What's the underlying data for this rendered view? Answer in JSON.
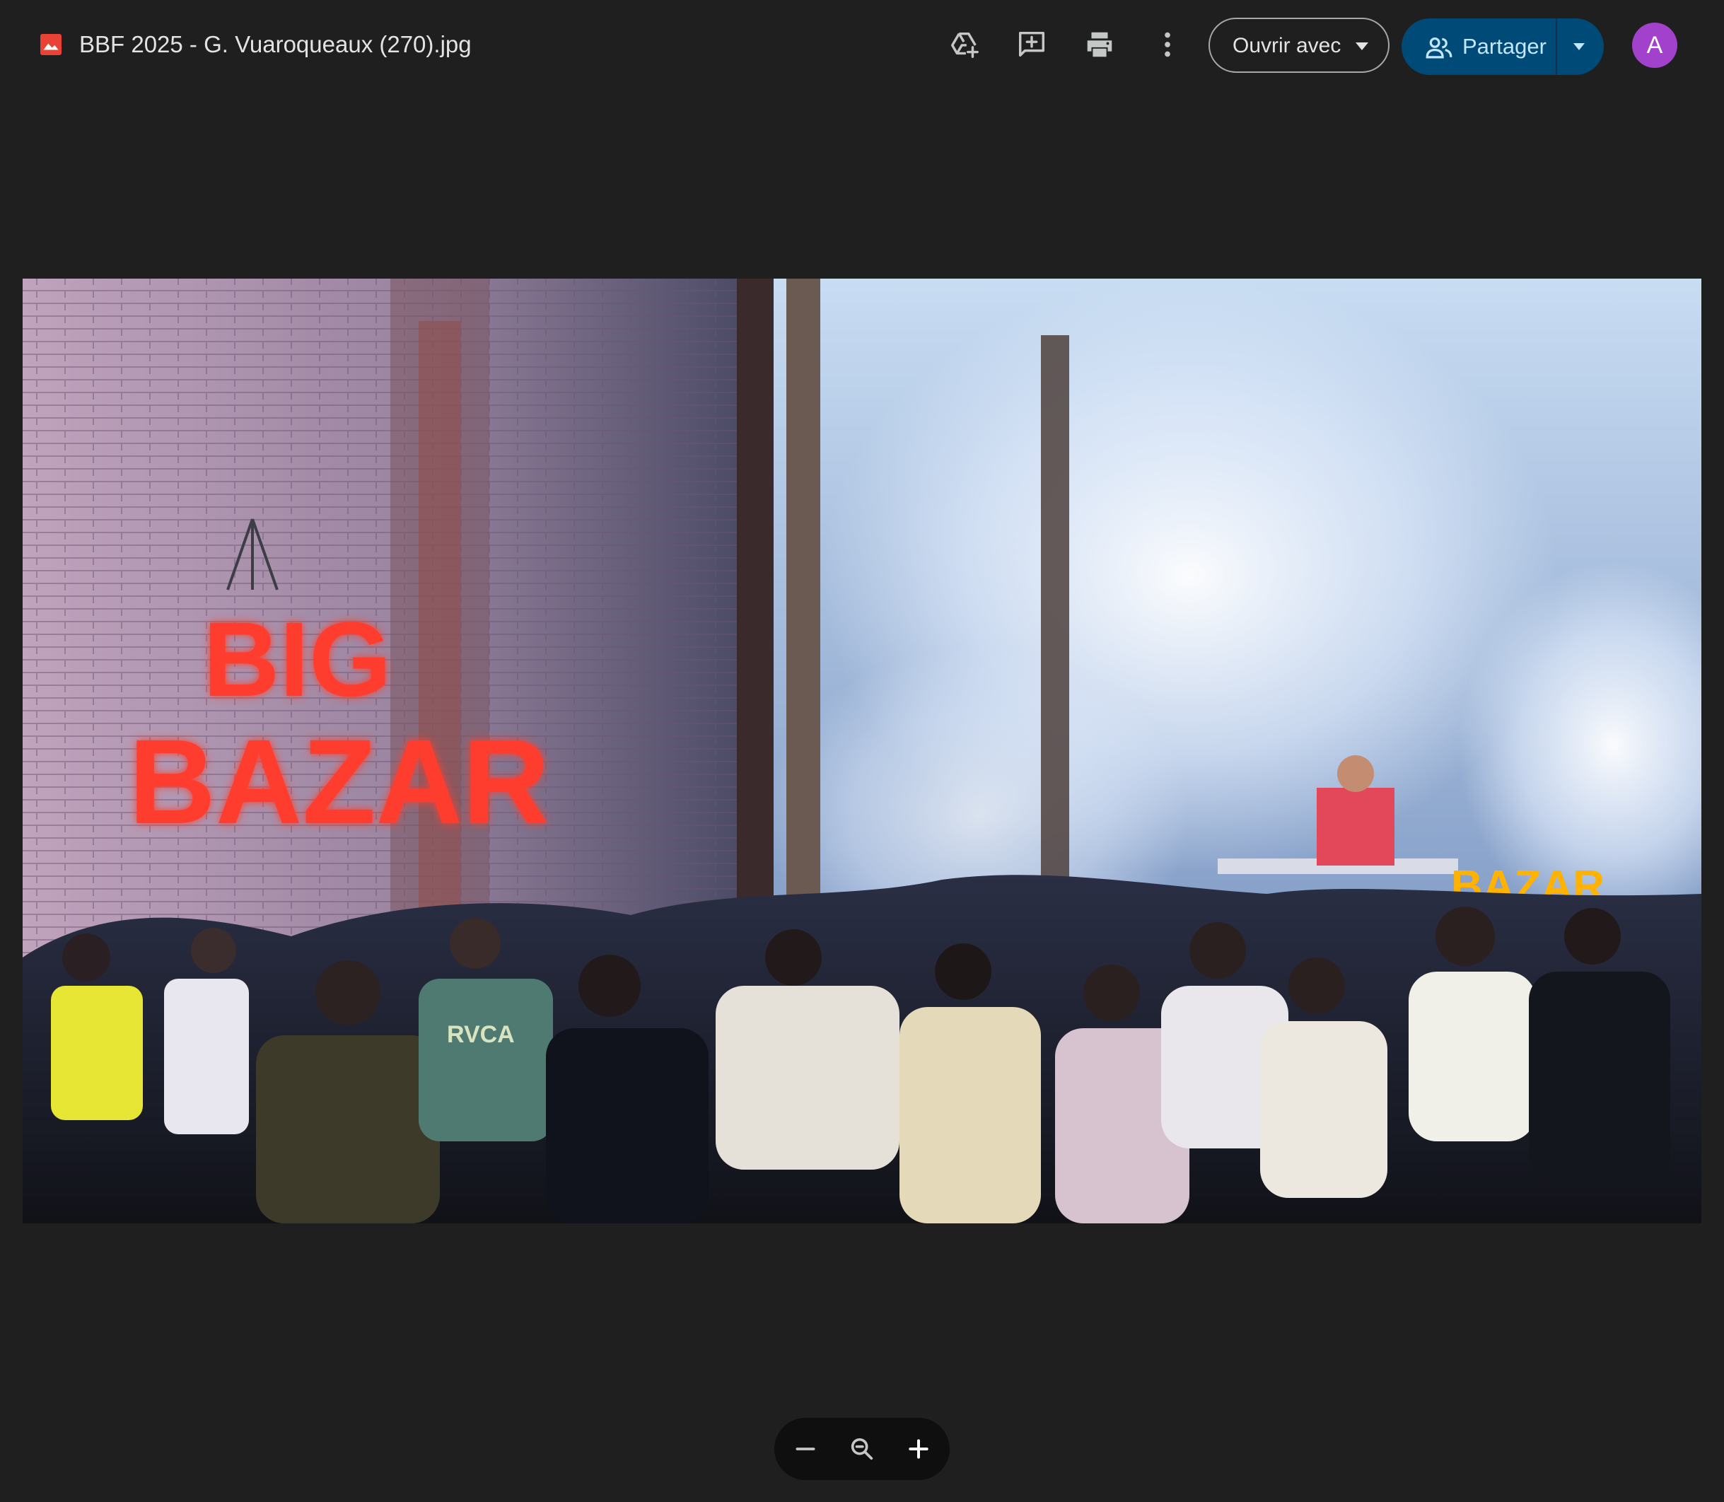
{
  "header": {
    "file_title": "BBF 2025 - G. Vuaroqueaux (270).jpg",
    "file_icon": "image-file-icon",
    "toolbar": [
      {
        "name": "add-to-drive",
        "icon": "drive-add-icon"
      },
      {
        "name": "add-comment",
        "icon": "comment-add-icon"
      },
      {
        "name": "print",
        "icon": "print-icon"
      },
      {
        "name": "more-actions",
        "icon": "more-vert-icon"
      }
    ],
    "open_with_label": "Ouvrir avec",
    "share_label": "Partager",
    "avatar_initial": "A"
  },
  "viewer": {
    "photo_signs": {
      "wall_neon_line1": "BIG",
      "wall_neon_line2": "BAZAR",
      "stage_sign": "BAZAR",
      "tshirt_print": "RVCA"
    }
  },
  "zoom_controls": {
    "zoom_out_icon": "minus-icon",
    "zoom_reset_icon": "zoom-icon",
    "zoom_in_icon": "plus-icon"
  },
  "colors": {
    "background": "#1f1f1f",
    "share_button": "#004a77",
    "share_text": "#c2e7ff",
    "avatar": "#a242cc",
    "file_icon": "#ea4335",
    "neon": "#ff3d2e",
    "stage_sign": "#ffb300"
  }
}
